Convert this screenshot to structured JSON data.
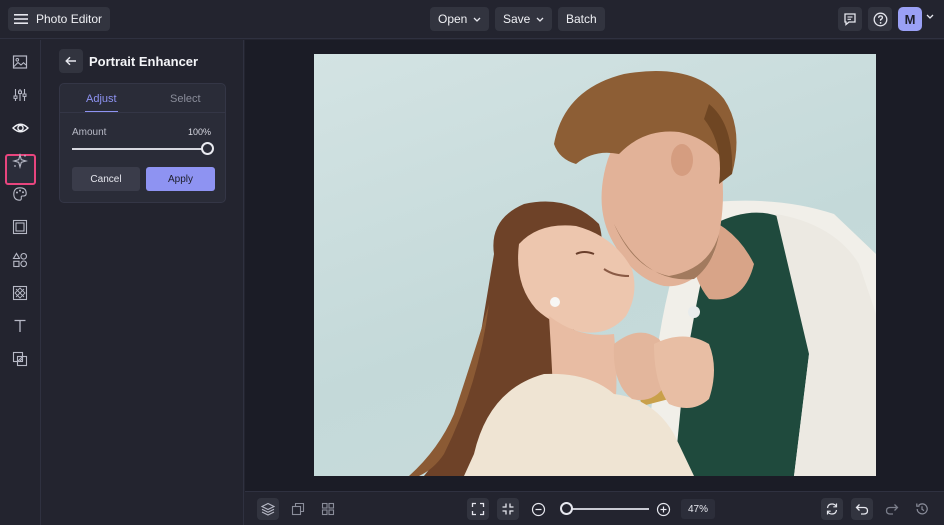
{
  "app": {
    "title": "Photo Editor"
  },
  "header": {
    "menu": [
      {
        "label": "Open",
        "has_dropdown": true
      },
      {
        "label": "Save",
        "has_dropdown": true
      },
      {
        "label": "Batch",
        "has_dropdown": false
      }
    ],
    "user_initial": "M"
  },
  "rail": {
    "items": [
      {
        "icon": "image-icon",
        "active": false
      },
      {
        "icon": "sliders-icon",
        "active": false
      },
      {
        "icon": "eye-icon",
        "active": true
      },
      {
        "icon": "sparkles-icon",
        "active": false
      },
      {
        "icon": "palette-icon",
        "active": false
      },
      {
        "icon": "frame-icon",
        "active": false
      },
      {
        "icon": "shapes-icon",
        "active": false
      },
      {
        "icon": "texture-icon",
        "active": false
      },
      {
        "icon": "text-icon",
        "active": false
      },
      {
        "icon": "overlay-icon",
        "active": false
      }
    ]
  },
  "panel": {
    "title": "Portrait Enhancer",
    "tabs": [
      {
        "label": "Adjust",
        "active": true
      },
      {
        "label": "Select",
        "active": false
      }
    ],
    "amount": {
      "label": "Amount",
      "value": "100%",
      "fraction": 1.0
    },
    "cancel_label": "Cancel",
    "apply_label": "Apply"
  },
  "zoom": {
    "value": "47%",
    "fraction": 0.0
  },
  "colors": {
    "accent": "#8e93f2",
    "active_highlight": "#e8457e",
    "background": "#23242f",
    "canvas": "#1b1c26"
  }
}
